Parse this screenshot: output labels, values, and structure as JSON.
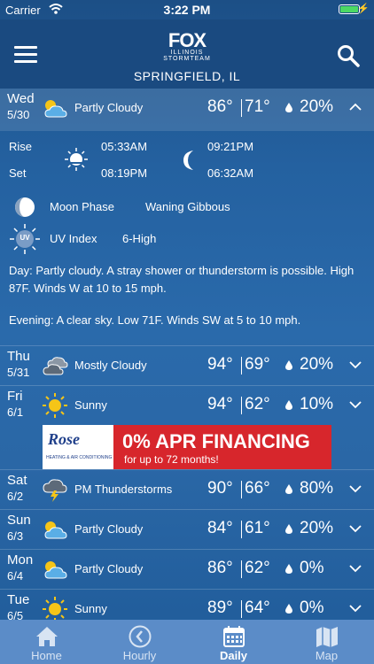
{
  "status": {
    "carrier": "Carrier",
    "time": "3:22 PM"
  },
  "header": {
    "logo_main": "FOX",
    "logo_sub": "ILLINOIS STORMTEAM",
    "location": "SPRINGFIELD, IL"
  },
  "expanded": {
    "dow": "Wed",
    "date": "5/30",
    "icon": "partly-cloudy-icon",
    "condition": "Partly Cloudy",
    "high": "86°",
    "low": "71°",
    "precip": "20%",
    "rise_label": "Rise",
    "set_label": "Set",
    "sunrise": "05:33AM",
    "sunset": "08:19PM",
    "moonrise": "09:21PM",
    "moonset": "06:32AM",
    "moon_phase_label": "Moon Phase",
    "moon_phase_value": "Waning Gibbous",
    "uv_label": "UV Index",
    "uv_value": "6-High",
    "uv_icon_text": "UV",
    "day_label": "Day",
    "day_text": ": Partly cloudy. A stray shower or thunderstorm is possible. High 87F. Winds W at 10 to 15 mph.",
    "evening_label": "Evening",
    "evening_text": ": A clear sky. Low 71F. Winds SW at 5 to 10 mph."
  },
  "days": [
    {
      "dow": "Thu",
      "date": "5/31",
      "icon": "mostly-cloudy-icon",
      "condition": "Mostly Cloudy",
      "high": "94°",
      "low": "69°",
      "precip": "20%"
    },
    {
      "dow": "Fri",
      "date": "6/1",
      "icon": "sunny-icon",
      "condition": "Sunny",
      "high": "94°",
      "low": "62°",
      "precip": "10%"
    },
    {
      "dow": "Sat",
      "date": "6/2",
      "icon": "thunderstorm-icon",
      "condition": "PM Thunderstorms",
      "high": "90°",
      "low": "66°",
      "precip": "80%"
    },
    {
      "dow": "Sun",
      "date": "6/3",
      "icon": "partly-cloudy-icon",
      "condition": "Partly Cloudy",
      "high": "84°",
      "low": "61°",
      "precip": "20%"
    },
    {
      "dow": "Mon",
      "date": "6/4",
      "icon": "partly-cloudy-icon",
      "condition": "Partly Cloudy",
      "high": "86°",
      "low": "62°",
      "precip": "0%"
    },
    {
      "dow": "Tue",
      "date": "6/5",
      "icon": "sunny-icon",
      "condition": "Sunny",
      "high": "89°",
      "low": "64°",
      "precip": "0%"
    }
  ],
  "ad": {
    "logo": "Rose",
    "logo_tag": "HEATING & AIR CONDITIONING",
    "title": "0% APR FINANCING",
    "subtitle": "for up to 72 months!"
  },
  "tabs": [
    {
      "label": "Home",
      "icon": "home-icon"
    },
    {
      "label": "Hourly",
      "icon": "clock-icon"
    },
    {
      "label": "Daily",
      "icon": "calendar-icon"
    },
    {
      "label": "Map",
      "icon": "map-icon"
    }
  ],
  "active_tab": "Daily"
}
